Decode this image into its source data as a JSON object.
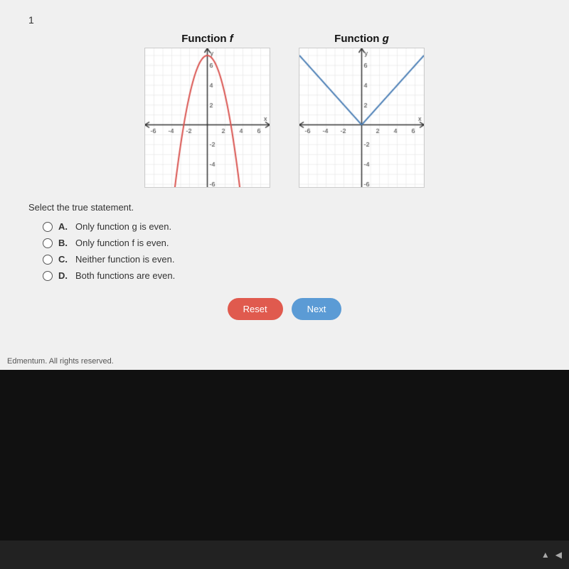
{
  "page": {
    "question_number": "1",
    "graph_f_title": "Function f",
    "graph_g_title": "Function g",
    "select_statement": "Select the true statement.",
    "options": [
      {
        "letter": "A.",
        "text": "Only function g is even."
      },
      {
        "letter": "B.",
        "text": "Only function f is even."
      },
      {
        "letter": "C.",
        "text": "Neither function is even."
      },
      {
        "letter": "D.",
        "text": "Both functions are even."
      }
    ],
    "reset_label": "Reset",
    "next_label": "Next",
    "footer": "Edmentum. All rights reserved.",
    "colors": {
      "reset": "#e05a4e",
      "next": "#5b9bd5",
      "graph_f_curve": "#d9534f",
      "graph_g_curve": "#4a7eb5"
    }
  }
}
